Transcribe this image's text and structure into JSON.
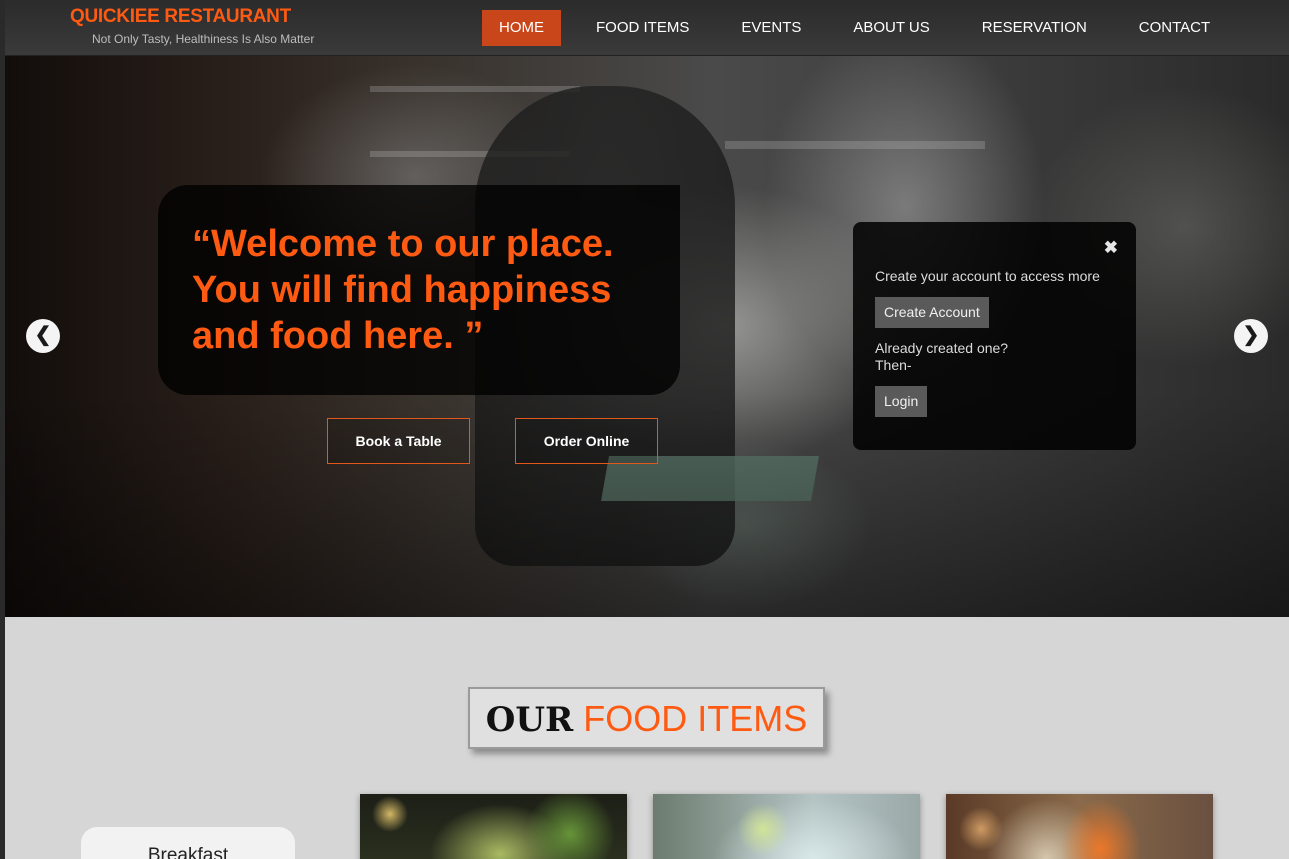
{
  "header": {
    "brand": "QUICKIEE RESTAURANT",
    "tagline": "Not Only Tasty, Healthiness Is Also Matter",
    "nav": [
      {
        "label": "HOME",
        "active": true
      },
      {
        "label": "FOOD ITEMS",
        "active": false
      },
      {
        "label": "EVENTS",
        "active": false
      },
      {
        "label": "ABOUT US",
        "active": false
      },
      {
        "label": "RESERVATION",
        "active": false
      },
      {
        "label": "CONTACT",
        "active": false
      }
    ]
  },
  "hero": {
    "welcome": "“Welcome to our place. You will find happiness and food here. ”",
    "book_label": "Book a Table",
    "order_label": "Order Online",
    "prev_arrow": "❮",
    "next_arrow": "❯"
  },
  "popup": {
    "close": "✖",
    "message": "Create your account to access more",
    "create_label": "Create Account",
    "already_line1": "Already created one?",
    "already_line2": "Then-",
    "login_label": "Login"
  },
  "food_section": {
    "title_our": "OUR",
    "title_food": "FOOD ITEMS",
    "category": "Breakfast"
  },
  "colors": {
    "accent": "#ff5a12",
    "nav_active": "#c9461a",
    "header_bg": "#2b2b2b",
    "section_bg": "#d6d6d6"
  }
}
